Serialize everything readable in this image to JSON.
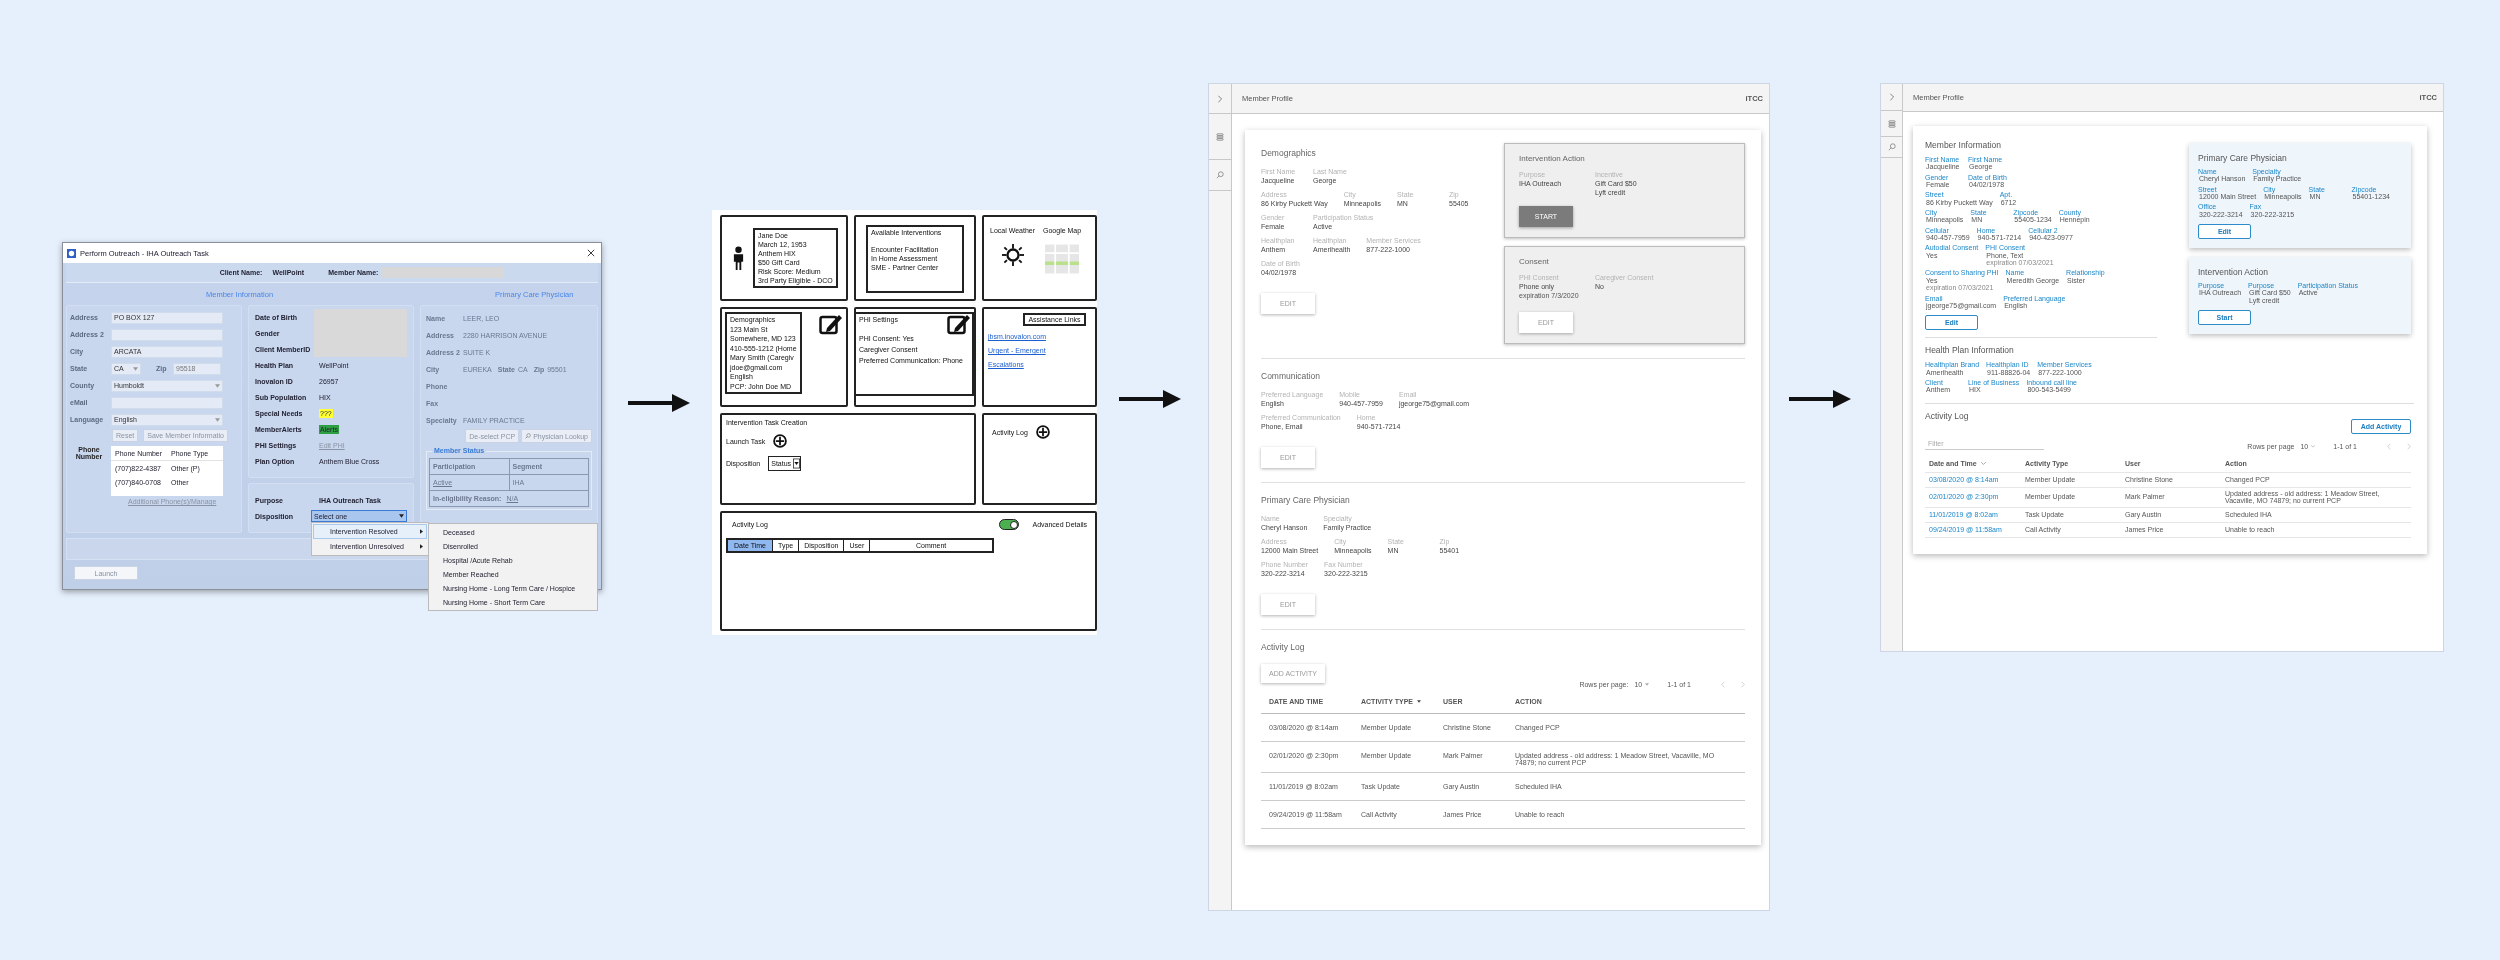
{
  "legacy_window": {
    "title": "Perform Outreach - IHA Outreach Task",
    "client_name_label": "Client Name:",
    "client_name": "WellPoint",
    "member_name_label": "Member Name:",
    "member_heading": "Member Information",
    "pcp_heading": "Primary Care Physician",
    "address_fields": [
      {
        "label": "Address",
        "kind": "input",
        "value": "PO BOX 127"
      },
      {
        "label": "Address 2",
        "kind": "input"
      },
      {
        "label": "City",
        "kind": "input",
        "value": "ARCATA"
      },
      {
        "label": "State",
        "kind": "state_zip",
        "value": "CA",
        "zip_label": "Zip",
        "zip": "95518"
      },
      {
        "label": "County",
        "kind": "select",
        "value": "Humboldt"
      },
      {
        "label": "eMail",
        "kind": "input"
      },
      {
        "label": "Language",
        "kind": "select",
        "value": "English"
      }
    ],
    "member_buttons": [
      "Reset",
      "Save Member Informatio"
    ],
    "phone_label": "Phone Number",
    "phone_table": {
      "columns": [
        "Phone Number",
        "Phone Type"
      ],
      "rows": [
        [
          "(707)822-4387",
          "Other (P)"
        ],
        [
          "(707)840-0708",
          "Other"
        ]
      ]
    },
    "phone_link": "Additional Phone(s)/Manage",
    "member_details": [
      {
        "label": "Date of Birth",
        "kind": "redacted"
      },
      {
        "label": "Gender",
        "kind": "redacted"
      },
      {
        "label": "Client MemberID",
        "kind": "redacted"
      },
      {
        "label": "Health Plan",
        "kind": "text",
        "value": "WellPoint"
      },
      {
        "label": "Inovalon ID",
        "kind": "text",
        "value": "26957"
      },
      {
        "label": "Sub Population",
        "kind": "text",
        "value": "HIX"
      },
      {
        "label": "Special Needs",
        "kind": "flag",
        "value": "???",
        "color": "#ffff33"
      },
      {
        "label": "MemberAlerts",
        "kind": "flag",
        "value": "Alerts",
        "color": "#2ea043"
      },
      {
        "label": "PHI Settings",
        "kind": "link",
        "value": "Edit PHI"
      },
      {
        "label": "Plan Option",
        "kind": "text",
        "value": "Anthem Blue Cross"
      }
    ],
    "purpose_label": "Purpose",
    "purpose": "IHA Outreach Task",
    "disposition_label": "Disposition",
    "disposition": "Select one",
    "disposition_menu": [
      {
        "label": "Intervention Resolved",
        "selected": true
      },
      {
        "label": "Intervention Unresolved",
        "selected": false
      }
    ],
    "submenu": [
      "Deceased",
      "Disenrolled",
      "Hospital /Acute Rehab",
      "Member Reached",
      "Nursing Home - Long Term Care / Hospice",
      "Nursing Home - Short Term Care"
    ],
    "pcp_fields": [
      {
        "label": "Name",
        "value": "LEER, LEO"
      },
      {
        "label": "Address",
        "value": "2280 HARRISON AVENUE"
      },
      {
        "label": "Address 2",
        "value": "SUITE K"
      },
      {
        "label": "City",
        "value": "EUREKA",
        "extras": [
          {
            "label": "State",
            "value": "CA"
          },
          {
            "label": "Zip",
            "value": "95501"
          }
        ]
      },
      {
        "label": "Phone"
      },
      {
        "label": "Fax"
      },
      {
        "label": "Specialty",
        "value": "FAMILY PRACTICE"
      }
    ],
    "pcp_buttons": [
      "De-select PCP",
      "Physician Lookup"
    ],
    "member_status": {
      "title": "Member Status",
      "columns": [
        "Participation",
        "Segment"
      ],
      "row": [
        "Active",
        "IHA"
      ],
      "reason_label": "In-eligibility Reason:",
      "reason": "N/A"
    },
    "launch": "Launch"
  },
  "wireframe_sketch": {
    "profile_lines": [
      "Jane Doe",
      "March 12, 1953",
      "Anthem HIX",
      "$50 Gift Card",
      "Risk Score: Medium",
      "3rd Party Eligible - DCO"
    ],
    "interventions": {
      "title": "Available Interventions",
      "items": [
        "Encounter Facilitation",
        "In Home Assessment",
        "SME - Partner Center"
      ]
    },
    "weather_label": "Local Weather",
    "map_label": "Google Map",
    "demographics": [
      "Demographics",
      "123 Main St",
      "Somewhere, MD 123",
      "410-555-1212 (Home",
      "Mary Smith (Caregiv",
      "jdoe@gmail.com",
      "English",
      "PCP: John Doe MD"
    ],
    "phi": {
      "title": "PHI Settings",
      "items": [
        "PHI Consent: Yes",
        "Caregiver Consent",
        "Preferred Communication: Phone"
      ]
    },
    "assistance": {
      "title": "Assistance Links",
      "links": [
        "jbsm.inovalon.com",
        "Urgent - Emergent",
        "Escalations"
      ]
    },
    "task_creation": {
      "title": "Intervention Task Creation",
      "launch_label": "Launch Task",
      "disposition_label": "Disposition",
      "status": "Status"
    },
    "activity_card": "Activity Log",
    "activity_log": {
      "title": "Activity Log",
      "advanced_label": "Advanced Details",
      "advanced_on": true,
      "columns": [
        {
          "label": "Date Time",
          "selected": true
        },
        {
          "label": "Type",
          "selected": false
        },
        {
          "label": "Disposition",
          "selected": false
        },
        {
          "label": "User",
          "selected": false
        },
        {
          "label": "Comment",
          "selected": false
        }
      ]
    }
  },
  "grey_mockup": {
    "title": "Member Profile",
    "brand": "iTCC",
    "demographics": {
      "title": "Demographics",
      "rows": [
        [
          {
            "label": "First Name",
            "value": "Jacqueline"
          },
          {
            "label": "Last Name",
            "value": "George"
          }
        ],
        [
          {
            "label": "Address",
            "value": "86 Kirby Puckett Way"
          },
          {
            "label": "City",
            "value": "Minneapolis"
          },
          {
            "label": "State",
            "value": "MN"
          },
          {
            "label": "Zip",
            "value": "55405"
          }
        ],
        [
          {
            "label": "Gender",
            "value": "Female"
          },
          {
            "label": "Participation Status",
            "value": "Active"
          }
        ],
        [
          {
            "label": "Healthplan",
            "value": "Anthem"
          },
          {
            "label": "Healthplan",
            "value": "Amerihealth"
          },
          {
            "label": "Member Services",
            "value": "877-222-1000"
          }
        ],
        [
          {
            "label": "Date of Birth",
            "value": "04/02/1978"
          }
        ]
      ],
      "button": "EDIT"
    },
    "intervention": {
      "title": "Intervention Action",
      "fields": [
        {
          "label": "Purpose",
          "value": "IHA Outreach"
        },
        {
          "label": "Incentive",
          "value": "Gift Card $50",
          "extra": "Lyft credit"
        }
      ],
      "button": "START"
    },
    "consent": {
      "title": "Consent",
      "fields": [
        {
          "label": "PHI Consent",
          "value": "Phone only",
          "note": "expiration 7/3/2020"
        },
        {
          "label": "Caregiver Consent",
          "value": "No"
        }
      ],
      "button": "EDIT"
    },
    "communication": {
      "title": "Communication",
      "rows": [
        [
          {
            "label": "Preferred Language",
            "value": "English"
          },
          {
            "label": "Mobile",
            "value": "940-457-7959"
          },
          {
            "label": "Email",
            "value": "jgeorge75@gmail.com"
          }
        ],
        [
          {
            "label": "Preferred Communication",
            "value": "Phone, Email"
          },
          {
            "label": "Home",
            "value": "940-571-7214"
          }
        ]
      ],
      "button": "EDIT"
    },
    "pcp": {
      "title": "Primary Care Physician",
      "rows": [
        [
          {
            "label": "Name",
            "value": "Cheryl Hanson"
          },
          {
            "label": "Specialty",
            "value": "Family Practice"
          }
        ],
        [
          {
            "label": "Address",
            "value": "12000 Main Street"
          },
          {
            "label": "City",
            "value": "Minneapolis"
          },
          {
            "label": "State",
            "value": "MN"
          },
          {
            "label": "Zip",
            "value": "55401"
          }
        ],
        [
          {
            "label": "Phone Number",
            "value": "320-222-3214"
          },
          {
            "label": "Fax Number",
            "value": "320-222-3215"
          }
        ]
      ],
      "button": "EDIT"
    },
    "activity": {
      "title": "Activity Log",
      "button": "ADD ACTIVITY",
      "rows_per_page_label": "Rows per page:",
      "rows_per_page": "10",
      "range": "1-1 of 1",
      "columns": [
        {
          "label": "DATE AND TIME",
          "sorted": false
        },
        {
          "label": "ACTIVITY TYPE",
          "sorted": true
        },
        {
          "label": "USER",
          "sorted": false
        },
        {
          "label": "ACTION",
          "sorted": false
        }
      ],
      "rows": [
        [
          "03/08/2020 @ 8:14am",
          "Member Update",
          "Christine Stone",
          "Changed PCP"
        ],
        [
          "02/01/2020 @ 2:30pm",
          "Member Update",
          "Mark Palmer",
          "Updated address - old address: 1 Meadow Street, Vacaville, MO 74879; no current PCP"
        ],
        [
          "11/01/2019 @ 8:02am",
          "Task Update",
          "Gary Austin",
          "Scheduled IHA"
        ],
        [
          "09/24/2019 @ 11:58am",
          "Call Activity",
          "James Price",
          "Unable to reach"
        ]
      ]
    }
  },
  "final_mockup": {
    "title": "Member Profile",
    "brand": "iTCC",
    "member_info": {
      "title": "Member Information",
      "rows": [
        [
          {
            "label": "First Name",
            "value": "Jacqueline"
          },
          {
            "label": "First Name",
            "value": "George"
          }
        ],
        [
          {
            "label": "Gender",
            "value": "Female"
          },
          {
            "label": "Date of Birth",
            "value": "04/02/1978"
          }
        ],
        [
          {
            "label": "Street",
            "value": "86 Kirby Puckett Way"
          },
          {
            "label": "Apt.",
            "value": "6712"
          }
        ],
        [
          {
            "label": "City",
            "value": "Minneapolis"
          },
          {
            "label": "State",
            "value": "MN"
          },
          {
            "label": "Zipcode",
            "value": "55405-1234"
          },
          {
            "label": "County",
            "value": "Hennepin"
          }
        ],
        [
          {
            "label": "Cellular",
            "value": "940-457-7959"
          },
          {
            "label": "Home",
            "value": "940-571-7214"
          },
          {
            "label": "Cellular 2",
            "value": "940-423-0977"
          }
        ],
        [
          {
            "label": "Autodial Consent",
            "value": "Yes"
          },
          {
            "label": "PHI Consent",
            "value": "Phone, Text",
            "note": "expiration 07/03/2021"
          }
        ],
        [
          {
            "label": "Consent to Sharing PHI",
            "value": "Yes",
            "note": "expiration 07/03/2021"
          },
          {
            "label": "Name",
            "value": "Meredith George"
          },
          {
            "label": "Relationship",
            "value": "Sister"
          }
        ],
        [
          {
            "label": "Email",
            "value": "jgeorge75@gmail.com"
          },
          {
            "label": "Preferred Language",
            "value": "English"
          }
        ]
      ],
      "button": "Edit"
    },
    "health_plan": {
      "title": "Health Plan Information",
      "rows": [
        [
          {
            "label": "Healthplan Brand",
            "value": "Amerihealth"
          },
          {
            "label": "Healthplan ID",
            "value": "911-88826-04"
          },
          {
            "label": "Member Services",
            "value": "877-222-1000"
          }
        ],
        [
          {
            "label": "Client",
            "value": "Anthem"
          },
          {
            "label": "Line of Business",
            "value": "HIX"
          },
          {
            "label": "Inbound call line",
            "value": "800-543-5499"
          }
        ]
      ]
    },
    "pcp": {
      "title": "Primary Care Physician",
      "rows": [
        [
          {
            "label": "Name",
            "value": "Cheryl Hanson"
          },
          {
            "label": "Specialty",
            "value": "Family Practice"
          }
        ],
        [
          {
            "label": "Street",
            "value": "12000 Main Street"
          },
          {
            "label": "City",
            "value": "Minneapolis"
          },
          {
            "label": "State",
            "value": "MN"
          },
          {
            "label": "Zipcode",
            "value": "55401-1234"
          }
        ],
        [
          {
            "label": "Office",
            "value": "320-222-3214"
          },
          {
            "label": "Fax",
            "value": "320-222-3215"
          }
        ]
      ],
      "button": "Edit"
    },
    "intervention": {
      "title": "Intervention Action",
      "rows": [
        [
          {
            "label": "Purpose",
            "value": "IHA Outreach"
          },
          {
            "label": "Purpose",
            "value": "Gift Card $50",
            "extra": "Lyft credit"
          },
          {
            "label": "Participation Status",
            "value": "Active"
          }
        ]
      ],
      "button": "Start"
    },
    "activity": {
      "title": "Activity Log",
      "button": "Add Activity",
      "filter_placeholder": "Filter",
      "rows_per_page_label": "Rows per page",
      "rows_per_page": "10",
      "range": "1-1 of 1",
      "columns": [
        {
          "label": "Date and Time",
          "sorted": true
        },
        {
          "label": "Activity Type",
          "sorted": false
        },
        {
          "label": "User",
          "sorted": false
        },
        {
          "label": "Action",
          "sorted": false
        }
      ],
      "rows": [
        [
          "03/08/2020 @  8:14am",
          "Member Update",
          "Christine Stone",
          "Changed PCP"
        ],
        [
          "02/01/2020 @  2:30pm",
          "Member Update",
          "Mark Palmer",
          "Updated address - old address: 1 Meadow Street, Vacaville, MO 74879; no current PCP"
        ],
        [
          "11/01/2019 @  8:02am",
          "Task Update",
          "Gary Austin",
          "Scheduled IHA"
        ],
        [
          "09/24/2019 @  11:58am",
          "Call Activity",
          "James Price",
          "Unable to reach"
        ]
      ]
    }
  }
}
